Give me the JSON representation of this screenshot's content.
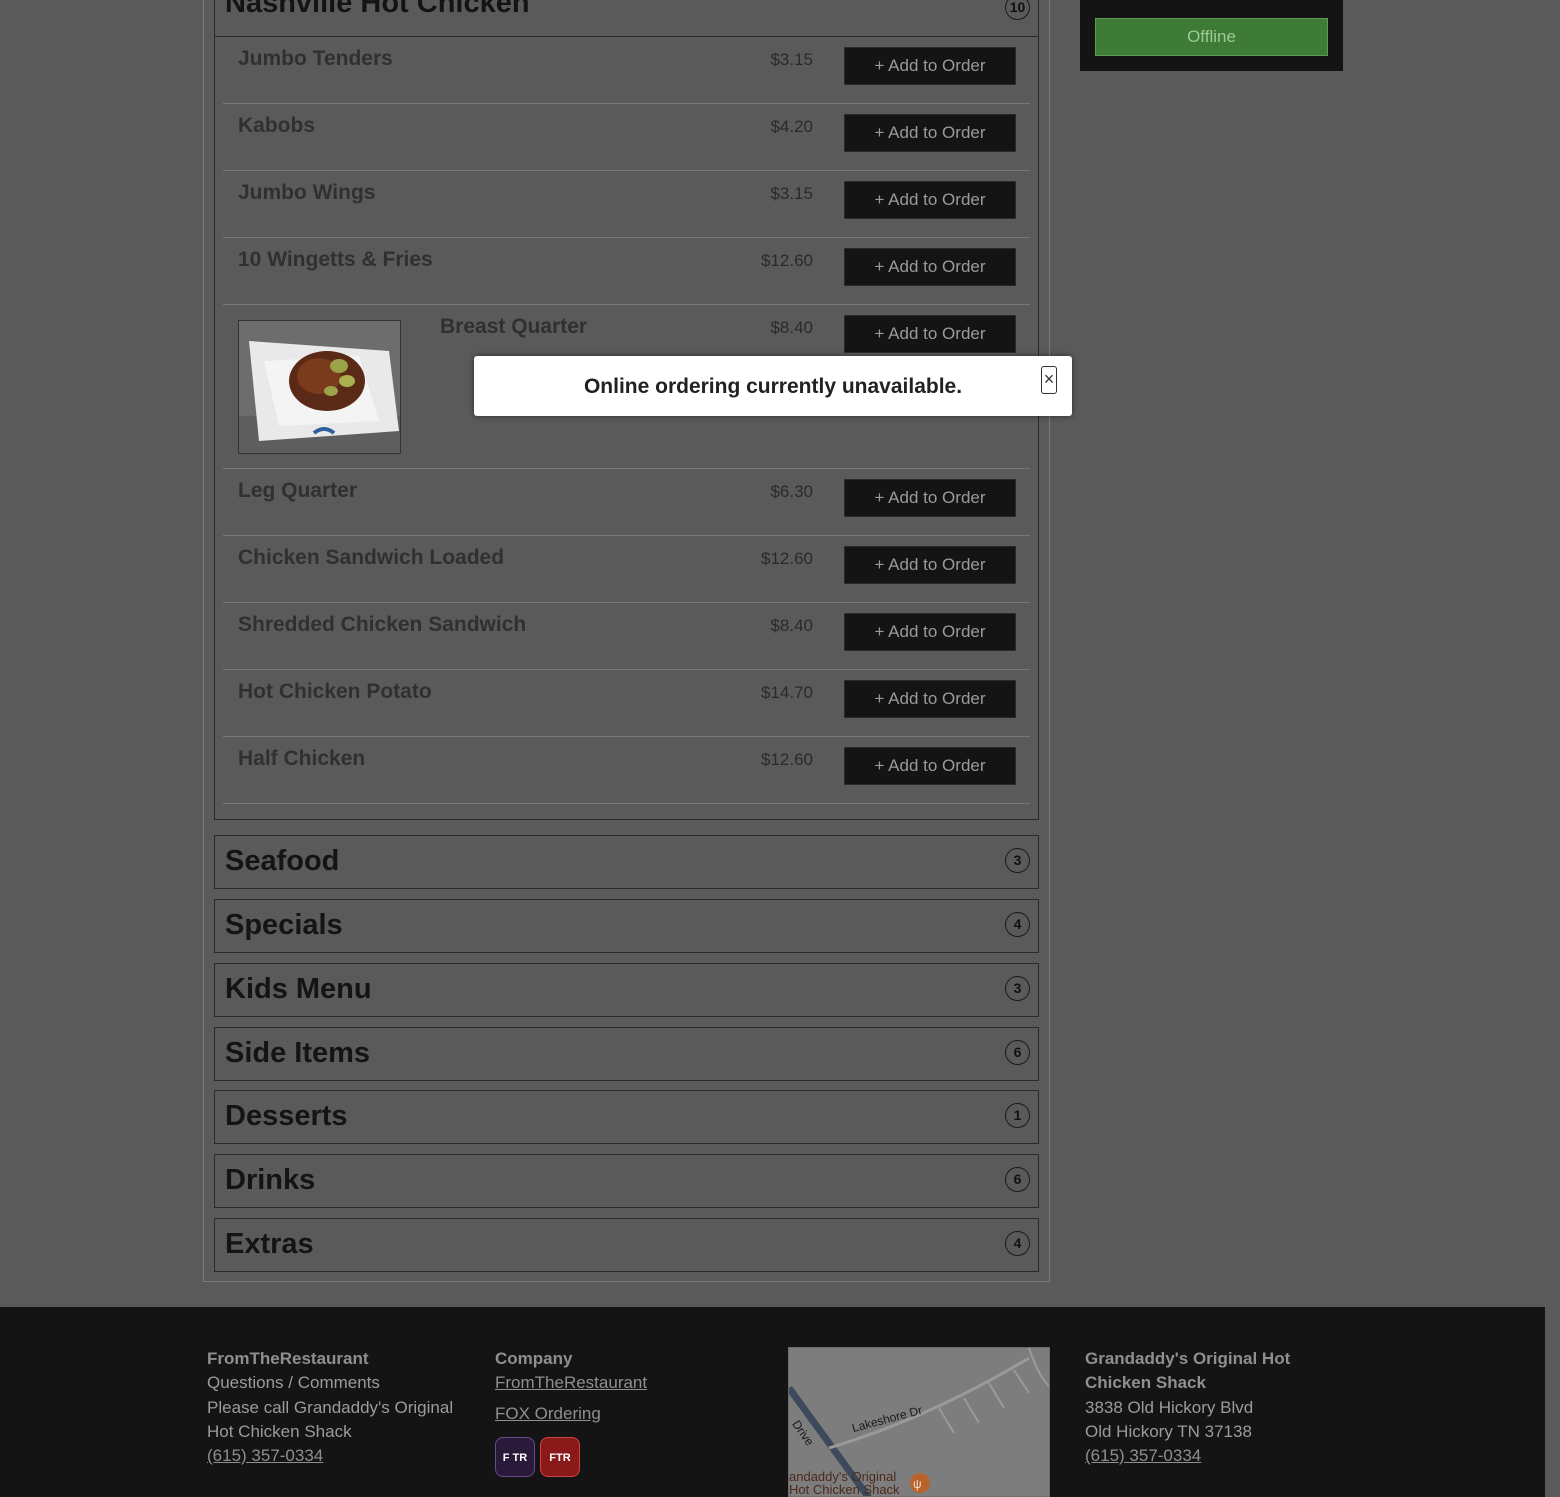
{
  "menu": {
    "open_category": {
      "title": "Nashville Hot Chicken",
      "count": "10",
      "items": [
        {
          "name": "Jumbo Tenders",
          "price": "$3.15",
          "button": "+ Add to Order"
        },
        {
          "name": "Kabobs",
          "price": "$4.20",
          "button": "+ Add to Order"
        },
        {
          "name": "Jumbo Wings",
          "price": "$3.15",
          "button": "+ Add to Order"
        },
        {
          "name": "10 Wingetts & Fries",
          "price": "$12.60",
          "button": "+ Add to Order"
        },
        {
          "name": "Breast Quarter",
          "price": "$8.40",
          "button": "+ Add to Order"
        },
        {
          "name": "Leg Quarter",
          "price": "$6.30",
          "button": "+ Add to Order"
        },
        {
          "name": "Chicken Sandwich Loaded",
          "price": "$12.60",
          "button": "+ Add to Order"
        },
        {
          "name": "Shredded Chicken Sandwich",
          "price": "$8.40",
          "button": "+ Add to Order"
        },
        {
          "name": "Hot Chicken Potato",
          "price": "$14.70",
          "button": "+ Add to Order"
        },
        {
          "name": "Half Chicken",
          "price": "$12.60",
          "button": "+ Add to Order"
        }
      ]
    },
    "categories": [
      {
        "title": "Seafood",
        "count": "3"
      },
      {
        "title": "Specials",
        "count": "4"
      },
      {
        "title": "Kids Menu",
        "count": "3"
      },
      {
        "title": "Side Items",
        "count": "6"
      },
      {
        "title": "Desserts",
        "count": "1"
      },
      {
        "title": "Drinks",
        "count": "6"
      },
      {
        "title": "Extras",
        "count": "4"
      }
    ]
  },
  "sidebar": {
    "status_button": "Offline"
  },
  "modal": {
    "message": "Online ordering currently unavailable.",
    "close": "×"
  },
  "footer": {
    "col1": {
      "heading": "FromTheRestaurant",
      "line1": "Questions / Comments",
      "line2": "Please call Grandaddy's Original",
      "line3": "Hot Chicken Shack",
      "phone": "(615) 357-0334"
    },
    "col2": {
      "heading": "Company",
      "link1": "FromTheRestaurant",
      "link2": "FOX Ordering",
      "badge1": "F TR",
      "badge2": "FTR"
    },
    "map": {
      "street1": "Lakeshore Dr",
      "street2": "Drive",
      "place_line1": "andaddy's Original",
      "place_line2": "Hot Chicken Shack"
    },
    "col4": {
      "heading_line1": "Grandaddy's Original Hot",
      "heading_line2": "Chicken Shack",
      "address1": "3838 Old Hickory Blvd",
      "address2": "Old Hickory TN 37138",
      "phone": "(615) 357-0334"
    }
  },
  "colors": {
    "page_bg": "#5a5a5a",
    "button_bg": "#141414",
    "offline_green": "#3e7b37",
    "footer_bg": "#141414"
  }
}
